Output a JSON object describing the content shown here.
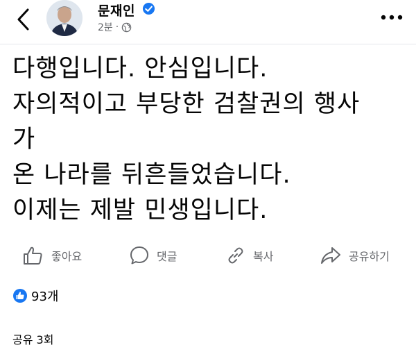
{
  "post": {
    "author": "문재인",
    "time": "2분",
    "separator": "·",
    "lines": [
      "다행입니다. 안심입니다.",
      "자의적이고 부당한 검찰권의 행사",
      "가",
      "온 나라를 뒤흔들었습니다.",
      "이제는 제발 민생입니다."
    ]
  },
  "actions": {
    "like": "좋아요",
    "comment": "댓글",
    "copy": "복사",
    "share": "공유하기"
  },
  "reactions": {
    "count": "93개"
  },
  "shares": {
    "label": "공유 3회"
  },
  "colors": {
    "brand": "#1877f2",
    "muted": "#65676b",
    "text": "#050505"
  }
}
